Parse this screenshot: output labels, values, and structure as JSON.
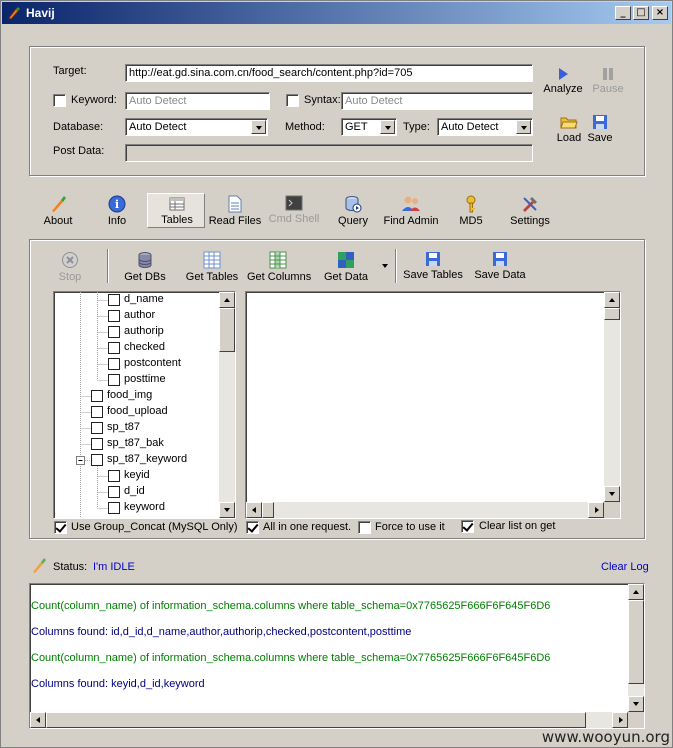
{
  "window": {
    "title": "Havij",
    "minimize": "_",
    "maximize": "□",
    "close": "×"
  },
  "target": {
    "target_label": "Target:",
    "target_value": "http://eat.gd.sina.com.cn/food_search/content.php?id=705",
    "keyword_label": "Keyword:",
    "keyword_placeholder": "Auto Detect",
    "syntax_label": "Syntax:",
    "syntax_placeholder": "Auto Detect",
    "database_label": "Database:",
    "database_value": "Auto Detect",
    "method_label": "Method:",
    "method_value": "GET",
    "type_label": "Type:",
    "type_value": "Auto Detect",
    "post_data_label": "Post Data:",
    "analyze_label": "Analyze",
    "pause_label": "Pause",
    "load_label": "Load",
    "save_label": "Save"
  },
  "main_tabs": [
    {
      "label": "About"
    },
    {
      "label": "Info"
    },
    {
      "label": "Tables"
    },
    {
      "label": "Read Files"
    },
    {
      "label": "Cmd Shell"
    },
    {
      "label": "Query"
    },
    {
      "label": "Find Admin"
    },
    {
      "label": "MD5"
    },
    {
      "label": "Settings"
    }
  ],
  "tables_toolbar": {
    "stop": "Stop",
    "get_dbs": "Get DBs",
    "get_tables": "Get Tables",
    "get_columns": "Get Columns",
    "get_data": "Get Data",
    "save_tables": "Save Tables",
    "save_data": "Save Data"
  },
  "tree": [
    {
      "label": "d_name",
      "level": 2
    },
    {
      "label": "author",
      "level": 2
    },
    {
      "label": "authorip",
      "level": 2
    },
    {
      "label": "checked",
      "level": 2
    },
    {
      "label": "postcontent",
      "level": 2
    },
    {
      "label": "posttime",
      "level": 2
    },
    {
      "label": "food_img",
      "level": 1
    },
    {
      "label": "food_upload",
      "level": 1
    },
    {
      "label": "sp_t87",
      "level": 1
    },
    {
      "label": "sp_t87_bak",
      "level": 1
    },
    {
      "label": "sp_t87_keyword",
      "level": 1,
      "expanded": true
    },
    {
      "label": "keyid",
      "level": 2
    },
    {
      "label": "d_id",
      "level": 2
    },
    {
      "label": "keyword",
      "level": 2
    }
  ],
  "options": {
    "group_concat": "Use Group_Concat (MySQL Only)",
    "all_in_one": "All in one request.",
    "force": "Force to use it",
    "clear_list": "Clear list on get"
  },
  "status": {
    "label": "Status:",
    "value": "I'm IDLE",
    "clear_log": "Clear Log"
  },
  "log": [
    {
      "text": "Count(column_name) of information_schema.columns where table_schema=0x7765625F666F6F645F6D6",
      "color": "#008000"
    },
    {
      "text": "Columns found: id,d_id,d_name,author,authorip,checked,postcontent,posttime",
      "color": "#000080"
    },
    {
      "text": "Count(column_name) of information_schema.columns where table_schema=0x7765625F666F6F645F6D6",
      "color": "#008000"
    },
    {
      "text": "Columns found: keyid,d_id,keyword",
      "color": "#000080"
    }
  ],
  "watermark": "www.wooyun.org",
  "colors": {
    "titlebar_start": "#0a246a",
    "titlebar_end": "#a6caf0",
    "link": "#0000cc",
    "log_green": "#008000",
    "log_blue": "#000080"
  }
}
